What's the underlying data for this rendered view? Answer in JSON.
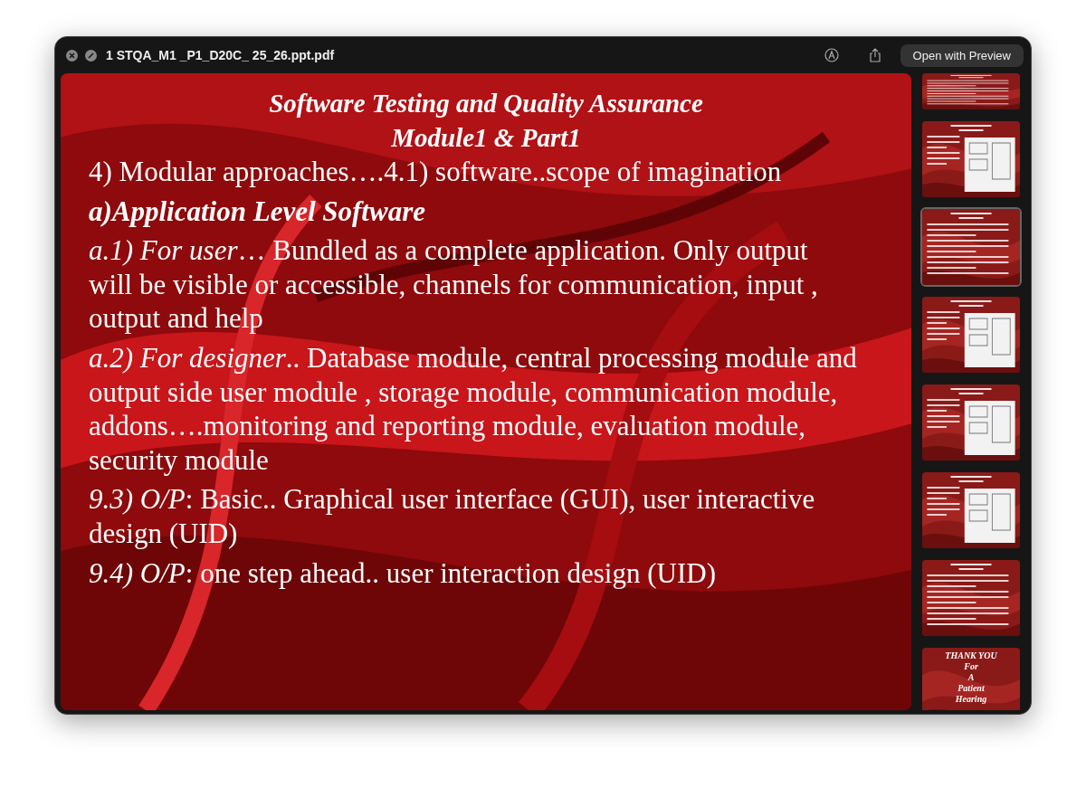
{
  "window": {
    "title": "1 STQA_M1 _P1_D20C_ 25_26.ppt.pdf",
    "open_button": "Open with Preview"
  },
  "slide": {
    "title_lines": [
      "Software Testing and Quality Assurance",
      "Module1 & Part1"
    ],
    "paragraphs": [
      {
        "kind": "plain",
        "text": "4) Modular approaches….4.1) software..scope of imagination"
      },
      {
        "kind": "heading",
        "text": "a)Application Level Software"
      },
      {
        "kind": "plain",
        "text": "*a.1) For user*… Bundled as a complete application. Only output will be visible or accessible, channels for communication, input , output and help"
      },
      {
        "kind": "plain",
        "text": "*a.2) For designer*.. Database module, central processing module and output side user module , storage module, communication module, addons….monitoring and reporting module, evaluation module, security module"
      },
      {
        "kind": "plain",
        "text": "*9.3) O/P*: Basic.. Graphical user interface (GUI), user interactive design (UID)"
      },
      {
        "kind": "plain",
        "text": "*9.4) O/P*: one step ahead.. user interaction design (UID)"
      }
    ]
  },
  "thumbnails": [
    {
      "kind": "text",
      "selected": false
    },
    {
      "kind": "diagram",
      "selected": false
    },
    {
      "kind": "text",
      "selected": true
    },
    {
      "kind": "diagram",
      "selected": false
    },
    {
      "kind": "diagram",
      "selected": false
    },
    {
      "kind": "diagram",
      "selected": false
    },
    {
      "kind": "text",
      "selected": false
    },
    {
      "kind": "thanks",
      "selected": false,
      "lines": [
        "THANK YOU",
        "For",
        "A",
        "Patient",
        "Hearing"
      ]
    }
  ]
}
